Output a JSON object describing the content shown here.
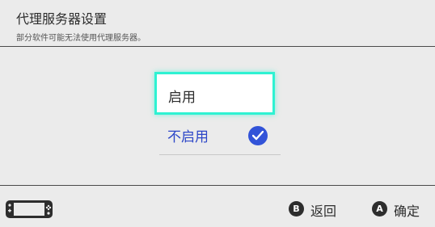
{
  "header": {
    "title": "代理服务器设置",
    "subtitle": "部分软件可能无法使用代理服务器。"
  },
  "options": [
    {
      "label": "启用",
      "focused": true,
      "selected": false
    },
    {
      "label": "不启用",
      "focused": false,
      "selected": true
    }
  ],
  "footer": {
    "console_icon": "handheld-console-icon",
    "back": {
      "key": "B",
      "label": "返回"
    },
    "confirm": {
      "key": "A",
      "label": "确定"
    }
  },
  "colors": {
    "background": "#ebebeb",
    "focus_outline": "#2ef2d2",
    "selected_text": "#2d47c8",
    "check_badge": "#3253d8"
  }
}
